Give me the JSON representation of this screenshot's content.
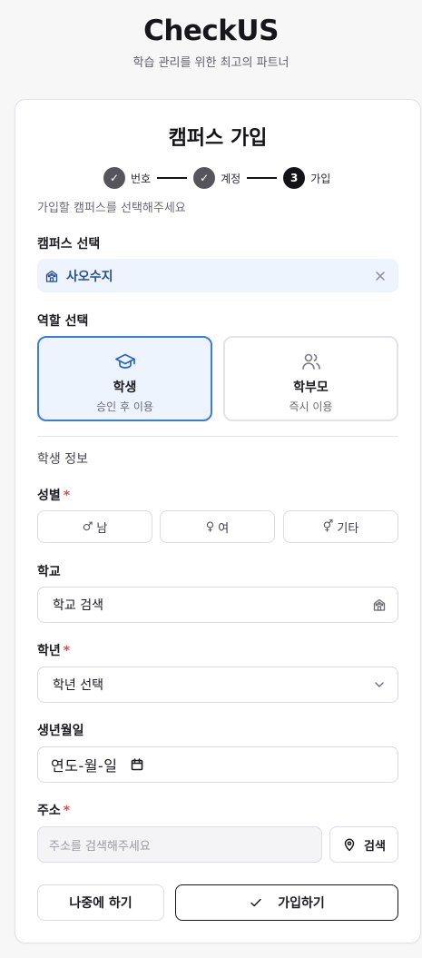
{
  "app": {
    "title": "CheckUS",
    "subtitle": "학습 관리를 위한 최고의 파트너"
  },
  "form": {
    "title": "캠퍼스 가입",
    "hint": "가입할 캠퍼스를 선택해주세요"
  },
  "stepper": {
    "steps": [
      {
        "number": "✓",
        "label": "번호",
        "state": "done"
      },
      {
        "number": "✓",
        "label": "계정",
        "state": "done"
      },
      {
        "number": "3",
        "label": "가입",
        "state": "active"
      }
    ]
  },
  "campus": {
    "label": "캠퍼스 선택",
    "selected": "사오수지",
    "icon": "building-icon",
    "accent": "#3b7ddd"
  },
  "role": {
    "label": "역할 선택",
    "options": [
      {
        "name": "학생",
        "desc": "승인 후 이용",
        "icon": "graduation-cap-icon",
        "selected": true
      },
      {
        "name": "학부모",
        "desc": "즉시 이용",
        "icon": "users-icon",
        "selected": false
      }
    ]
  },
  "student_info": {
    "section_label": "학생 정보",
    "gender": {
      "label": "성별",
      "required_mark": "*",
      "options": [
        {
          "symbol": "♂",
          "label": "남"
        },
        {
          "symbol": "♀",
          "label": "여"
        },
        {
          "symbol": "⚥",
          "label": "기타"
        }
      ]
    },
    "school": {
      "label": "학교",
      "value": "학교 검색",
      "icon": "building-icon"
    },
    "grade": {
      "label": "학년",
      "required_mark": "*",
      "value": "학년 선택",
      "icon": "chevron-down-icon"
    },
    "birthdate": {
      "label": "생년월일",
      "value": "연도-월-일",
      "icon": "calendar-icon"
    },
    "address": {
      "label": "주소",
      "required_mark": "*",
      "placeholder": "주소를 검색해주세요",
      "search_label": "검색",
      "search_icon": "map-pin-icon"
    }
  },
  "actions": {
    "later_label": "나중에 하기",
    "join_label": "가입하기",
    "join_icon": "check-icon"
  },
  "colors": {
    "accent": "#3b7ddd",
    "selected_bg": "#eef4fe",
    "required": "#e5484d",
    "step_done": "#55555b",
    "step_active": "#141418"
  }
}
